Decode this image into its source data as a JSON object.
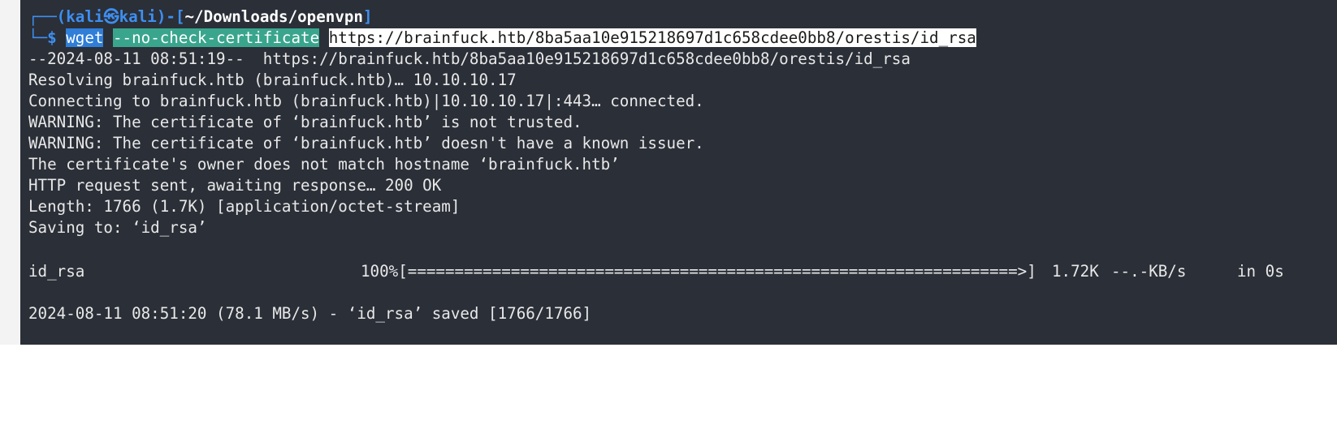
{
  "prompt": {
    "box_top": "┌──(",
    "user": "kali",
    "at_symbol": "㉿",
    "host": "kali",
    "mid": ")-[",
    "cwd": "~/Downloads/openvpn",
    "close": "]",
    "box_bottom": "└─",
    "dollar": "$ "
  },
  "command": {
    "program": "wget",
    "option": "--no-check-certificate",
    "url": "https://brainfuck.htb/8ba5aa10e915218697d1c658cdee0bb8/orestis/id_rsa"
  },
  "output": {
    "line_1": "--2024-08-11 08:51:19--  https://brainfuck.htb/8ba5aa10e915218697d1c658cdee0bb8/orestis/id_rsa",
    "line_2": "Resolving brainfuck.htb (brainfuck.htb)… 10.10.10.17",
    "line_3": "Connecting to brainfuck.htb (brainfuck.htb)|10.10.10.17|:443… connected.",
    "line_4": "WARNING: The certificate of ‘brainfuck.htb’ is not trusted.",
    "line_5": "WARNING: The certificate of ‘brainfuck.htb’ doesn't have a known issuer.",
    "line_6": "The certificate's owner does not match hostname ‘brainfuck.htb’",
    "line_7": "HTTP request sent, awaiting response… 200 OK",
    "line_8": "Length: 1766 (1.7K) [application/octet-stream]",
    "line_9": "Saving to: ‘id_rsa’",
    "progress_file": "id_rsa",
    "progress_percent": "100%[",
    "progress_bar": "=================================================================>",
    "progress_close": "]",
    "progress_size": "1.72K",
    "progress_speed": "--.-KB/s",
    "progress_time": "in 0s",
    "line_final": "2024-08-11 08:51:20 (78.1 MB/s) - ‘id_rsa’ saved [1766/1766]"
  },
  "colors": {
    "terminal_bg": "#2b2f38",
    "prompt_blue": "#3d8ff0",
    "cmd_highlight": "#2f7ed8",
    "option_highlight": "#3aa58d",
    "url_highlight": "#ffffff"
  }
}
